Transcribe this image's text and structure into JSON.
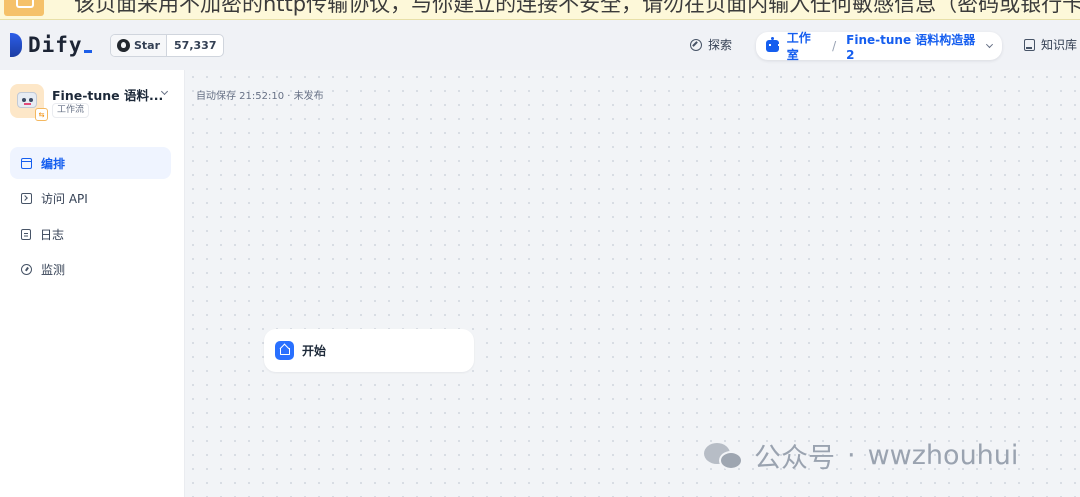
{
  "warning": {
    "text": "该页面采用不加密的http传输协议，与你建立的连接不安全，请勿在页面内输入任何敏感信息（密码或银行卡信息等），否"
  },
  "header": {
    "logo_text": "Dify",
    "github": {
      "star_label": "Star",
      "star_count": "57,337"
    },
    "explore_label": "探索",
    "studio": {
      "label": "工作室",
      "separator": "/",
      "app_name": "Fine-tune 语料构造器2"
    },
    "knowledge_label": "知识库"
  },
  "sidebar": {
    "app_name": "Fine-tune 语料...",
    "app_type": "工作流",
    "menu": [
      {
        "label": "编排",
        "icon": "layout-icon",
        "active": true
      },
      {
        "label": "访问 API",
        "icon": "terminal-icon",
        "active": false
      },
      {
        "label": "日志",
        "icon": "file-list-icon",
        "active": false
      },
      {
        "label": "监测",
        "icon": "gauge-icon",
        "active": false
      }
    ]
  },
  "canvas": {
    "autosave_text": "自动保存 21:52:10 · 未发布",
    "start_node_label": "开始"
  },
  "watermark": {
    "platform": "公众号",
    "dot": "·",
    "account": "wwzhouhui"
  },
  "colors": {
    "accent": "#155eef",
    "active_bg": "#eff4ff",
    "canvas_bg": "#f2f4f7",
    "banner_bg": "#fdf8d9"
  }
}
